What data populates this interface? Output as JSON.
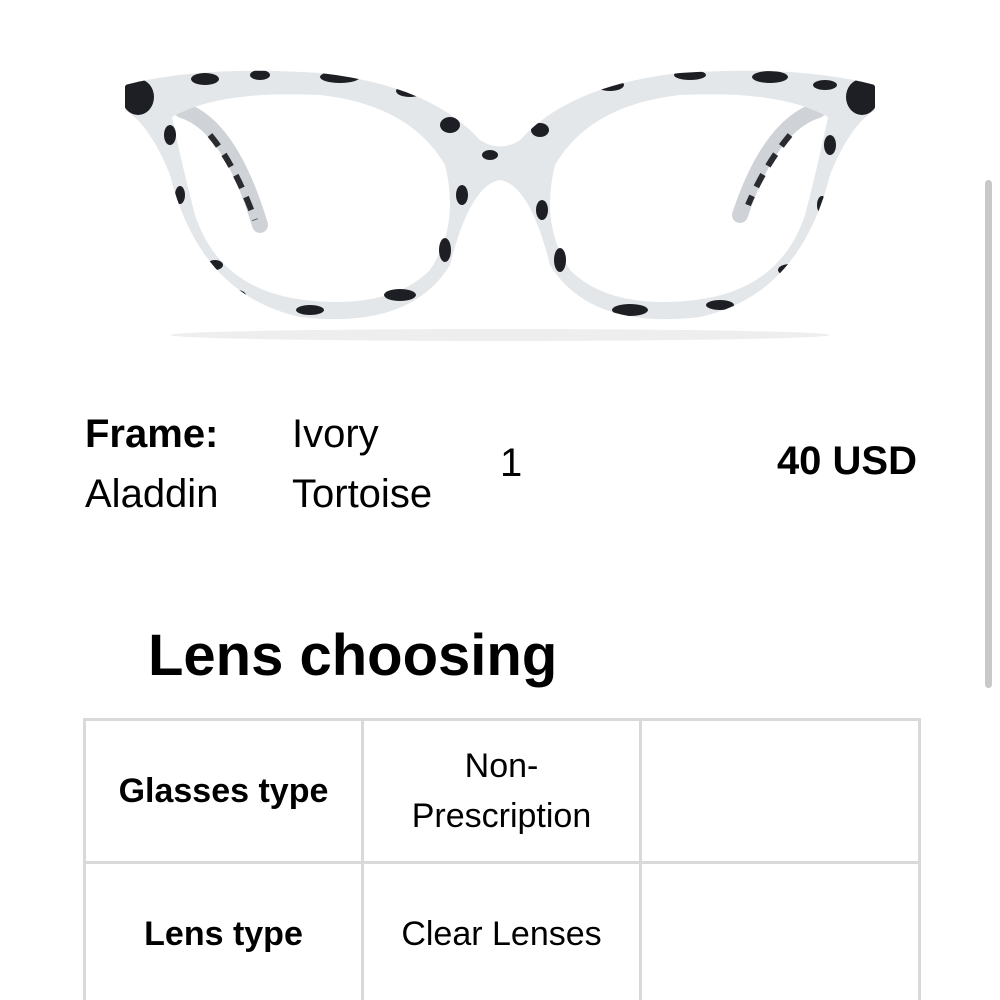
{
  "product": {
    "frame_label": "Frame:",
    "frame_name": "Aladdin",
    "color_line1": "Ivory",
    "color_line2": "Tortoise",
    "quantity": "1",
    "price": "40 USD"
  },
  "lens_section": {
    "title": "Lens choosing",
    "rows": [
      {
        "label": "Glasses type",
        "value_line1": "Non-",
        "value_line2": "Prescription",
        "extra": ""
      },
      {
        "label": "Lens type",
        "value_line1": "Clear Lenses",
        "value_line2": "",
        "extra": ""
      }
    ]
  },
  "colors": {
    "frame_base": "#e4e7ea",
    "frame_spots": "#1e1f24",
    "border": "#d9d9d9"
  },
  "icons": {
    "product_image": "ivory-tortoise-glasses-image"
  }
}
